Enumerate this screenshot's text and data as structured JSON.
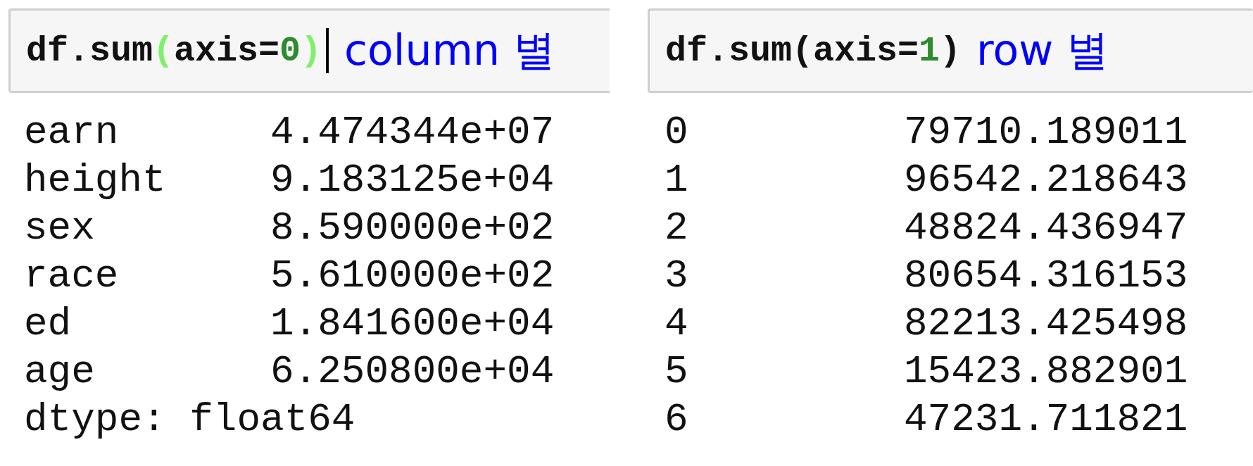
{
  "panels": [
    {
      "input": {
        "code": [
          {
            "text": "df.sum",
            "kind": "plain"
          },
          {
            "text": "(",
            "kind": "bracket-match"
          },
          {
            "text": "axis=",
            "kind": "plain"
          },
          {
            "text": "0",
            "kind": "number"
          },
          {
            "text": ")",
            "kind": "bracket-match"
          }
        ],
        "cursor": true,
        "annotation": "column 별"
      },
      "output": {
        "rows": [
          {
            "label": "earn",
            "value": "4.474344e+07"
          },
          {
            "label": "height",
            "value": "9.183125e+04"
          },
          {
            "label": "sex",
            "value": "8.590000e+02"
          },
          {
            "label": "race",
            "value": "5.610000e+02"
          },
          {
            "label": "ed",
            "value": "1.841600e+04"
          },
          {
            "label": "age",
            "value": "6.250800e+04"
          }
        ],
        "footer": "dtype: float64"
      }
    },
    {
      "input": {
        "code": [
          {
            "text": "df.sum(axis=",
            "kind": "plain"
          },
          {
            "text": "1",
            "kind": "number"
          },
          {
            "text": ")",
            "kind": "plain"
          }
        ],
        "cursor": false,
        "annotation": "row 별"
      },
      "output": {
        "rows": [
          {
            "label": "0",
            "value": "79710.189011"
          },
          {
            "label": "1",
            "value": "96542.218643"
          },
          {
            "label": "2",
            "value": "48824.436947"
          },
          {
            "label": "3",
            "value": "80654.316153"
          },
          {
            "label": "4",
            "value": "82213.425498"
          },
          {
            "label": "5",
            "value": "15423.882901"
          },
          {
            "label": "6",
            "value": "47231.711821"
          }
        ]
      }
    }
  ]
}
